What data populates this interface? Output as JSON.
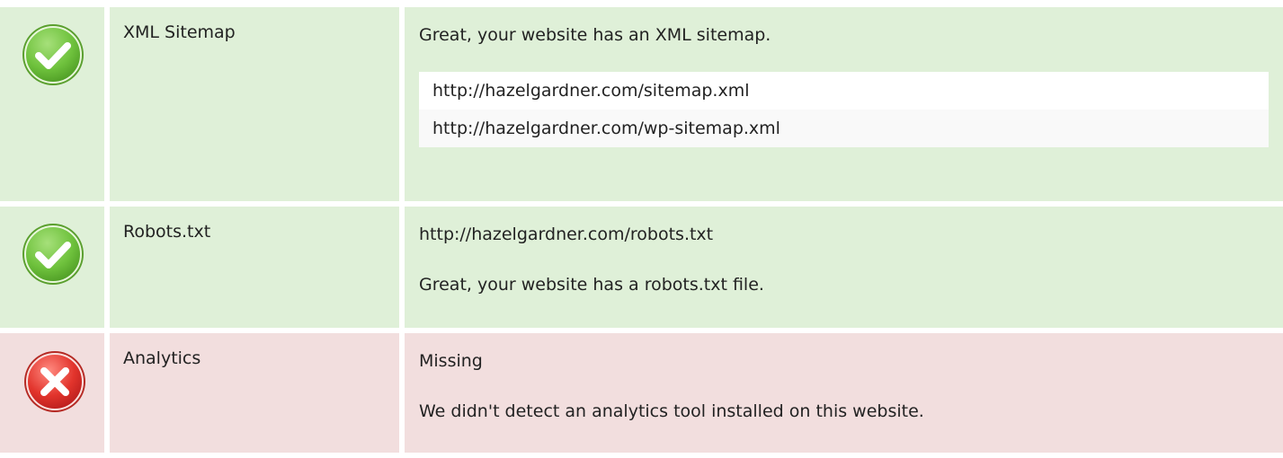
{
  "rows": [
    {
      "status": "pass",
      "icon": "check-circle-icon",
      "name": "XML Sitemap",
      "message": "Great, your website has an XML sitemap.",
      "urls": [
        "http://hazelgardner.com/sitemap.xml",
        "http://hazelgardner.com/wp-sitemap.xml"
      ]
    },
    {
      "status": "pass",
      "icon": "check-circle-icon",
      "name": "Robots.txt",
      "url": "http://hazelgardner.com/robots.txt",
      "message": "Great, your website has a robots.txt file."
    },
    {
      "status": "fail",
      "icon": "error-circle-icon",
      "name": "Analytics",
      "value": "Missing",
      "message": "We didn't detect an analytics tool installed on this website."
    }
  ],
  "colors": {
    "pass_bg": "#dff0d8",
    "fail_bg": "#f2dede",
    "pass_icon": "#6fc23d",
    "fail_icon": "#e2342c"
  }
}
